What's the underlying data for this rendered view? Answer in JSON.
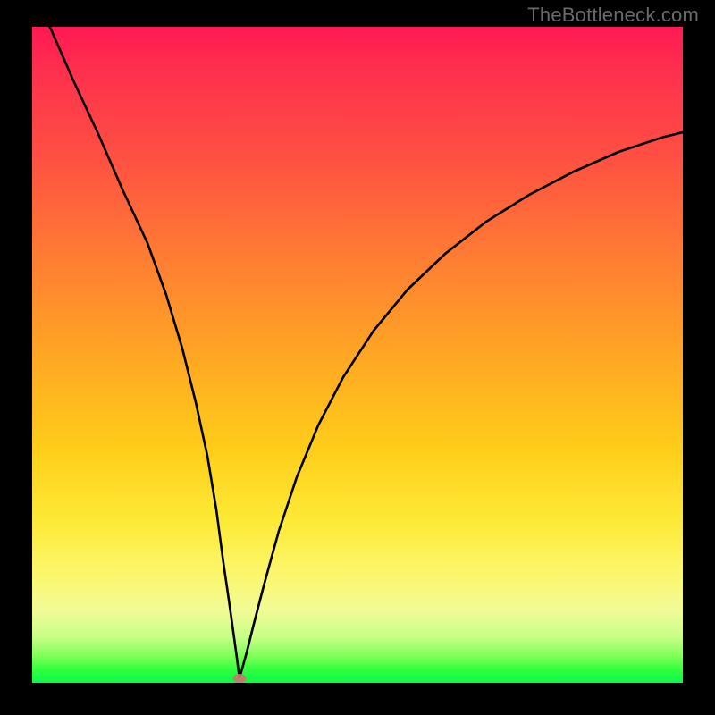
{
  "watermark": "TheBottleneck.com",
  "chart_data": {
    "type": "line",
    "title": "",
    "xlabel": "",
    "ylabel": "",
    "xlim": [
      0,
      100
    ],
    "ylim": [
      0,
      100
    ],
    "background_gradient": [
      "#ff1953",
      "#ff5042",
      "#ffa624",
      "#fde935",
      "#2fff3c"
    ],
    "series": [
      {
        "name": "bottleneck-curve-left",
        "x": [
          2,
          4,
          6,
          8,
          10,
          12,
          14,
          16,
          18,
          20,
          22,
          24,
          26,
          28,
          30,
          31.5
        ],
        "values": [
          100,
          93,
          86,
          80,
          73,
          66,
          59,
          52,
          46,
          39,
          32,
          24,
          17,
          10,
          3,
          1
        ]
      },
      {
        "name": "bottleneck-curve-right",
        "x": [
          31.5,
          33,
          35,
          38,
          41,
          45,
          50,
          55,
          60,
          66,
          72,
          78,
          85,
          92,
          100
        ],
        "values": [
          1,
          8,
          18,
          30,
          40,
          49,
          57,
          63,
          68,
          72,
          75,
          78,
          81,
          83,
          85
        ]
      }
    ],
    "marker": {
      "name": "minimum-point",
      "x": 31.5,
      "y": 1,
      "color": "#c47a6a"
    }
  }
}
